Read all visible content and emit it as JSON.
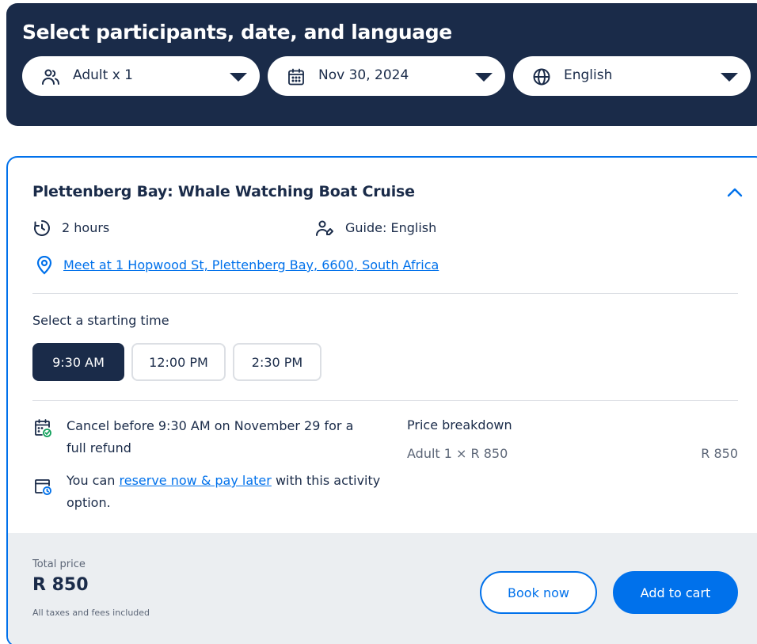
{
  "selector": {
    "title": "Select participants, date, and language",
    "participants": {
      "label": "Adult x 1",
      "icon": "participants-icon"
    },
    "date": {
      "label": "Nov 30, 2024",
      "icon": "calendar-icon"
    },
    "language": {
      "label": "English",
      "icon": "globe-icon"
    }
  },
  "activity": {
    "title": "Plettenberg Bay: Whale Watching Boat Cruise",
    "duration": "2 hours",
    "guide": "Guide: English",
    "meeting_point": "Meet at 1 Hopwood St, Plettenberg Bay, 6600, South Africa",
    "start_time_label": "Select a starting time",
    "time_slots": [
      {
        "label": "9:30 AM",
        "selected": true
      },
      {
        "label": "12:00 PM",
        "selected": false
      },
      {
        "label": "2:30 PM",
        "selected": false
      }
    ],
    "cancellation": "Cancel before 9:30 AM on November 29 for a full refund",
    "reserve": {
      "prefix": "You can ",
      "link": "reserve now & pay later",
      "suffix": " with this activity option."
    },
    "price_breakdown": {
      "title": "Price breakdown",
      "line_label": "Adult 1 × R 850",
      "line_amount": "R 850"
    }
  },
  "footer": {
    "total_label": "Total price",
    "total_amount": "R 850",
    "taxes_note": "All taxes and fees included",
    "book_now": "Book now",
    "add_to_cart": "Add to cart"
  },
  "colors": {
    "navy": "#1a2b49",
    "accent": "#0071eb",
    "footer_bg": "#ebeef1",
    "divider": "#dcdfe4"
  }
}
